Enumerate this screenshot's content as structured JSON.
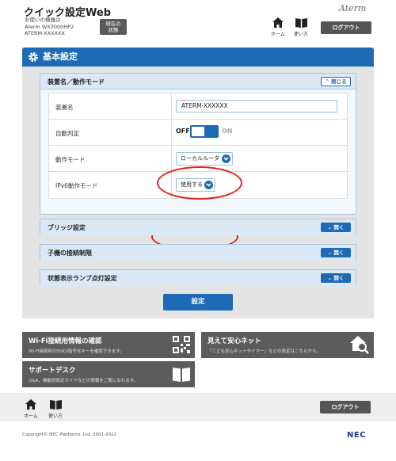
{
  "header": {
    "title": "クイック設定Web",
    "device_label": "お使いの機器は",
    "device_model": "Aterm WX3000HP2",
    "device_name": "ATERM-XXXXXX",
    "status_button": "現在の\n状態",
    "brand": "Aterm",
    "home_label": "ホーム",
    "help_label": "使い方",
    "logout_label": "ログアウト"
  },
  "panel": {
    "title": "基本設定",
    "section": {
      "title": "装置名／動作モード",
      "close_label": "閉じる",
      "rows": [
        {
          "label": "装置名",
          "value": "ATERM-XXXXXX"
        },
        {
          "label": "自動判定",
          "off_label": "OFF",
          "on_label": "ON"
        },
        {
          "label": "動作モード",
          "value": "ローカルルータ"
        },
        {
          "label": "IPv6動作モード",
          "value": "使用する"
        }
      ]
    },
    "collapsed_sections": [
      {
        "title": "ブリッジ設定",
        "open_label": "開く"
      },
      {
        "title": "子機の接続制限",
        "open_label": "開く"
      },
      {
        "title": "状態表示ランプ点灯設定",
        "open_label": "開く"
      }
    ],
    "apply_label": "設定"
  },
  "tiles": {
    "wifi": {
      "title": "Wi-Fi接続用情報の確認",
      "sub": "Wi-Fi接続用のSSID/暗号化キーを確認できます。"
    },
    "safe": {
      "title": "見えて安心ネット",
      "sub": "「こども安心ネットタイマー」などの設定はこちらから。"
    },
    "support": {
      "title": "サポートデスク",
      "sub": "Q&A、機能別設定ガイドなどの情報をご覧になれます。"
    }
  },
  "footer": {
    "home_label": "ホーム",
    "help_label": "使い方",
    "logout_label": "ログアウト",
    "copyright": "Copyright© NEC Platforms, Ltd. 2001-2022",
    "logo": "NEC"
  }
}
